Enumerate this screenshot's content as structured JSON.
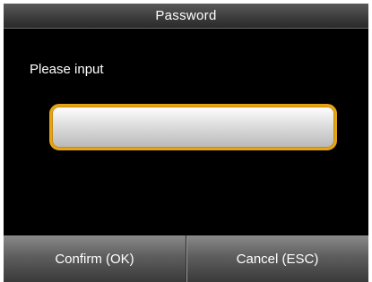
{
  "window": {
    "title": "Password"
  },
  "main": {
    "prompt": "Please input",
    "password_field": {
      "value": ""
    }
  },
  "softkeys": {
    "confirm_label": "Confirm (OK)",
    "cancel_label": "Cancel (ESC)"
  },
  "colors": {
    "background": "#000000",
    "input_border": "#e6a414",
    "text": "#ffffff"
  }
}
